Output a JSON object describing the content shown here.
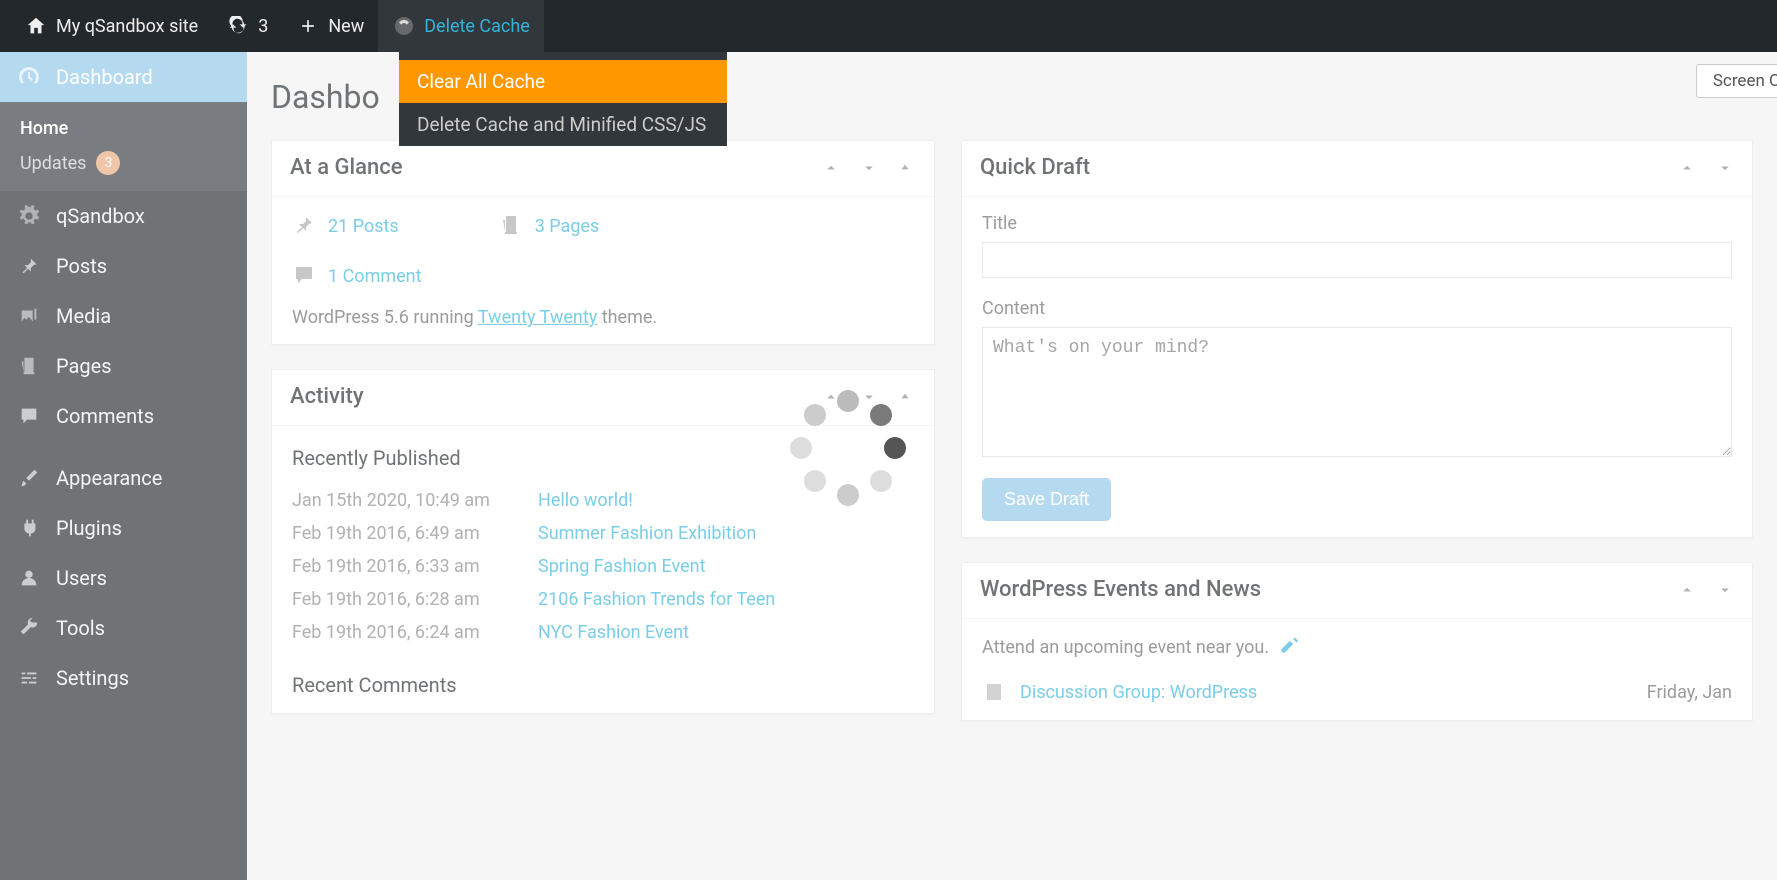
{
  "adminBar": {
    "siteName": "My qSandbox site",
    "updateCount": "3",
    "newLabel": "New",
    "deleteCache": "Delete Cache",
    "dropdown": {
      "clearAll": "Clear All Cache",
      "minified": "Delete Cache and Minified CSS/JS"
    },
    "screenOptions": "Screen Opti"
  },
  "sidebar": {
    "dashboard": "Dashboard",
    "home": "Home",
    "updates": "Updates",
    "updateBadge": "3",
    "qsandbox": "qSandbox",
    "posts": "Posts",
    "media": "Media",
    "pages": "Pages",
    "comments": "Comments",
    "appearance": "Appearance",
    "plugins": "Plugins",
    "users": "Users",
    "tools": "Tools",
    "settings": "Settings"
  },
  "pageTitle": "Dashbo",
  "glance": {
    "title": "At a Glance",
    "posts": "21 Posts",
    "pages": "3 Pages",
    "comments": "1 Comment",
    "wpRunning_before": "WordPress 5.6 running ",
    "theme": "Twenty Twenty",
    "wpRunning_after": " theme."
  },
  "activity": {
    "title": "Activity",
    "recentlyPublished": "Recently Published",
    "items": [
      {
        "date": "Jan 15th 2020, 10:49 am",
        "title": "Hello world!"
      },
      {
        "date": "Feb 19th 2016, 6:49 am",
        "title": "Summer Fashion Exhibition"
      },
      {
        "date": "Feb 19th 2016, 6:33 am",
        "title": "Spring Fashion Event"
      },
      {
        "date": "Feb 19th 2016, 6:28 am",
        "title": "2106 Fashion Trends for Teen"
      },
      {
        "date": "Feb 19th 2016, 6:24 am",
        "title": "NYC Fashion Event"
      }
    ],
    "recentComments": "Recent Comments"
  },
  "quickDraft": {
    "title": "Quick Draft",
    "titleLabel": "Title",
    "contentLabel": "Content",
    "contentPlaceholder": "What's on your mind?",
    "saveDraft": "Save Draft"
  },
  "eventsNews": {
    "title": "WordPress Events and News",
    "attend": "Attend an upcoming event near you.",
    "eventLink": "Discussion Group: WordPress",
    "eventDate": "Friday, Jan "
  }
}
